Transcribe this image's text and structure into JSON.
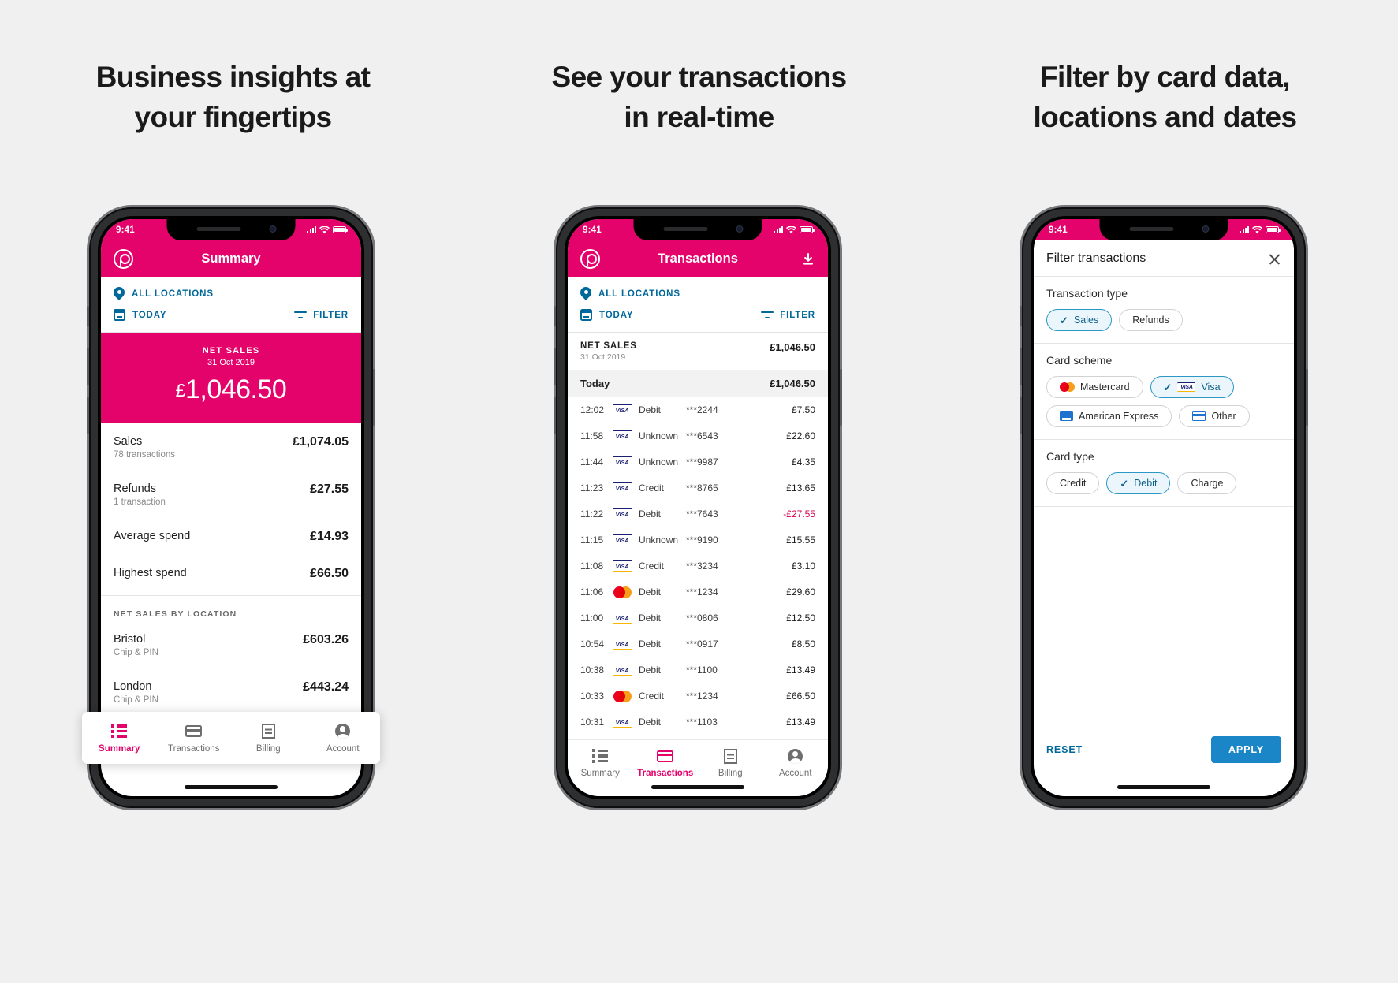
{
  "panels": [
    {
      "headline_line1": "Business insights at",
      "headline_line2": "your fingertips"
    },
    {
      "headline_line1": "See your transactions",
      "headline_line2": "in real-time"
    },
    {
      "headline_line1": "Filter by card data,",
      "headline_line2": "locations and dates"
    }
  ],
  "status": {
    "time": "9:41"
  },
  "brand": {
    "pink": "#e4036b",
    "blue": "#00689b",
    "apply_blue": "#1a86c8",
    "negative": "#d6004f"
  },
  "summary": {
    "app_title": "Summary",
    "locations_label": "ALL LOCATIONS",
    "date_label": "TODAY",
    "filter_label": "FILTER",
    "hero": {
      "label": "NET SALES",
      "date": "31 Oct 2019",
      "currency": "£",
      "amount": "1,046.50"
    },
    "rows": [
      {
        "name": "Sales",
        "sub": "78 transactions",
        "value": "£1,074.05"
      },
      {
        "name": "Refunds",
        "sub": "1 transaction",
        "value": "£27.55"
      },
      {
        "name": "Average spend",
        "sub": "",
        "value": "£14.93"
      },
      {
        "name": "Highest spend",
        "sub": "",
        "value": "£66.50"
      }
    ],
    "location_section_title": "NET SALES BY LOCATION",
    "locations": [
      {
        "name": "Bristol",
        "sub": "Chip & PIN",
        "value": "£603.26"
      },
      {
        "name": "London",
        "sub": "Chip & PIN",
        "value": "£443.24"
      }
    ],
    "tabs": [
      {
        "label": "Summary",
        "icon": "list-icon",
        "active": true
      },
      {
        "label": "Transactions",
        "icon": "card-icon",
        "active": false
      },
      {
        "label": "Billing",
        "icon": "receipt-icon",
        "active": false
      },
      {
        "label": "Account",
        "icon": "account-icon",
        "active": false
      }
    ]
  },
  "transactions": {
    "app_title": "Transactions",
    "download_icon": "download-icon",
    "locations_label": "ALL LOCATIONS",
    "date_label": "TODAY",
    "filter_label": "FILTER",
    "net": {
      "label": "NET SALES",
      "date": "31 Oct 2019",
      "amount": "£1,046.50"
    },
    "day": {
      "label": "Today",
      "amount": "£1,046.50"
    },
    "columns": [
      "time",
      "scheme",
      "type",
      "card",
      "amount"
    ],
    "rows": [
      {
        "time": "12:02",
        "scheme": "visa",
        "type": "Debit",
        "card": "***2244",
        "amount": "£7.50",
        "negative": false
      },
      {
        "time": "11:58",
        "scheme": "visa",
        "type": "Unknown",
        "card": "***6543",
        "amount": "£22.60",
        "negative": false
      },
      {
        "time": "11:44",
        "scheme": "visa",
        "type": "Unknown",
        "card": "***9987",
        "amount": "£4.35",
        "negative": false
      },
      {
        "time": "11:23",
        "scheme": "visa",
        "type": "Credit",
        "card": "***8765",
        "amount": "£13.65",
        "negative": false
      },
      {
        "time": "11:22",
        "scheme": "visa",
        "type": "Debit",
        "card": "***7643",
        "amount": "-£27.55",
        "negative": true
      },
      {
        "time": "11:15",
        "scheme": "visa",
        "type": "Unknown",
        "card": "***9190",
        "amount": "£15.55",
        "negative": false
      },
      {
        "time": "11:08",
        "scheme": "visa",
        "type": "Credit",
        "card": "***3234",
        "amount": "£3.10",
        "negative": false
      },
      {
        "time": "11:06",
        "scheme": "mastercard",
        "type": "Debit",
        "card": "***1234",
        "amount": "£29.60",
        "negative": false
      },
      {
        "time": "11:00",
        "scheme": "visa",
        "type": "Debit",
        "card": "***0806",
        "amount": "£12.50",
        "negative": false
      },
      {
        "time": "10:54",
        "scheme": "visa",
        "type": "Debit",
        "card": "***0917",
        "amount": "£8.50",
        "negative": false
      },
      {
        "time": "10:38",
        "scheme": "visa",
        "type": "Debit",
        "card": "***1100",
        "amount": "£13.49",
        "negative": false
      },
      {
        "time": "10:33",
        "scheme": "mastercard",
        "type": "Credit",
        "card": "***1234",
        "amount": "£66.50",
        "negative": false
      },
      {
        "time": "10:31",
        "scheme": "visa",
        "type": "Debit",
        "card": "***1103",
        "amount": "£13.49",
        "negative": false
      }
    ],
    "tabs": [
      {
        "label": "Summary",
        "icon": "list-icon",
        "active": false
      },
      {
        "label": "Transactions",
        "icon": "card-icon",
        "active": true
      },
      {
        "label": "Billing",
        "icon": "receipt-icon",
        "active": false
      },
      {
        "label": "Account",
        "icon": "account-icon",
        "active": false
      }
    ]
  },
  "filter": {
    "title": "Filter transactions",
    "close_icon": "close-icon",
    "groups": [
      {
        "title": "Transaction type",
        "chips": [
          {
            "label": "Sales",
            "selected": true,
            "icon": "none"
          },
          {
            "label": "Refunds",
            "selected": false,
            "icon": "none"
          }
        ]
      },
      {
        "title": "Card scheme",
        "chips": [
          {
            "label": "Mastercard",
            "selected": false,
            "icon": "mastercard-icon"
          },
          {
            "label": "Visa",
            "selected": true,
            "icon": "visa-icon"
          },
          {
            "label": "American Express",
            "selected": false,
            "icon": "amex-icon"
          },
          {
            "label": "Other",
            "selected": false,
            "icon": "other-card-icon"
          }
        ]
      },
      {
        "title": "Card type",
        "chips": [
          {
            "label": "Credit",
            "selected": false,
            "icon": "none"
          },
          {
            "label": "Debit",
            "selected": true,
            "icon": "none"
          },
          {
            "label": "Charge",
            "selected": false,
            "icon": "none"
          }
        ]
      }
    ],
    "reset_label": "RESET",
    "apply_label": "APPLY"
  }
}
